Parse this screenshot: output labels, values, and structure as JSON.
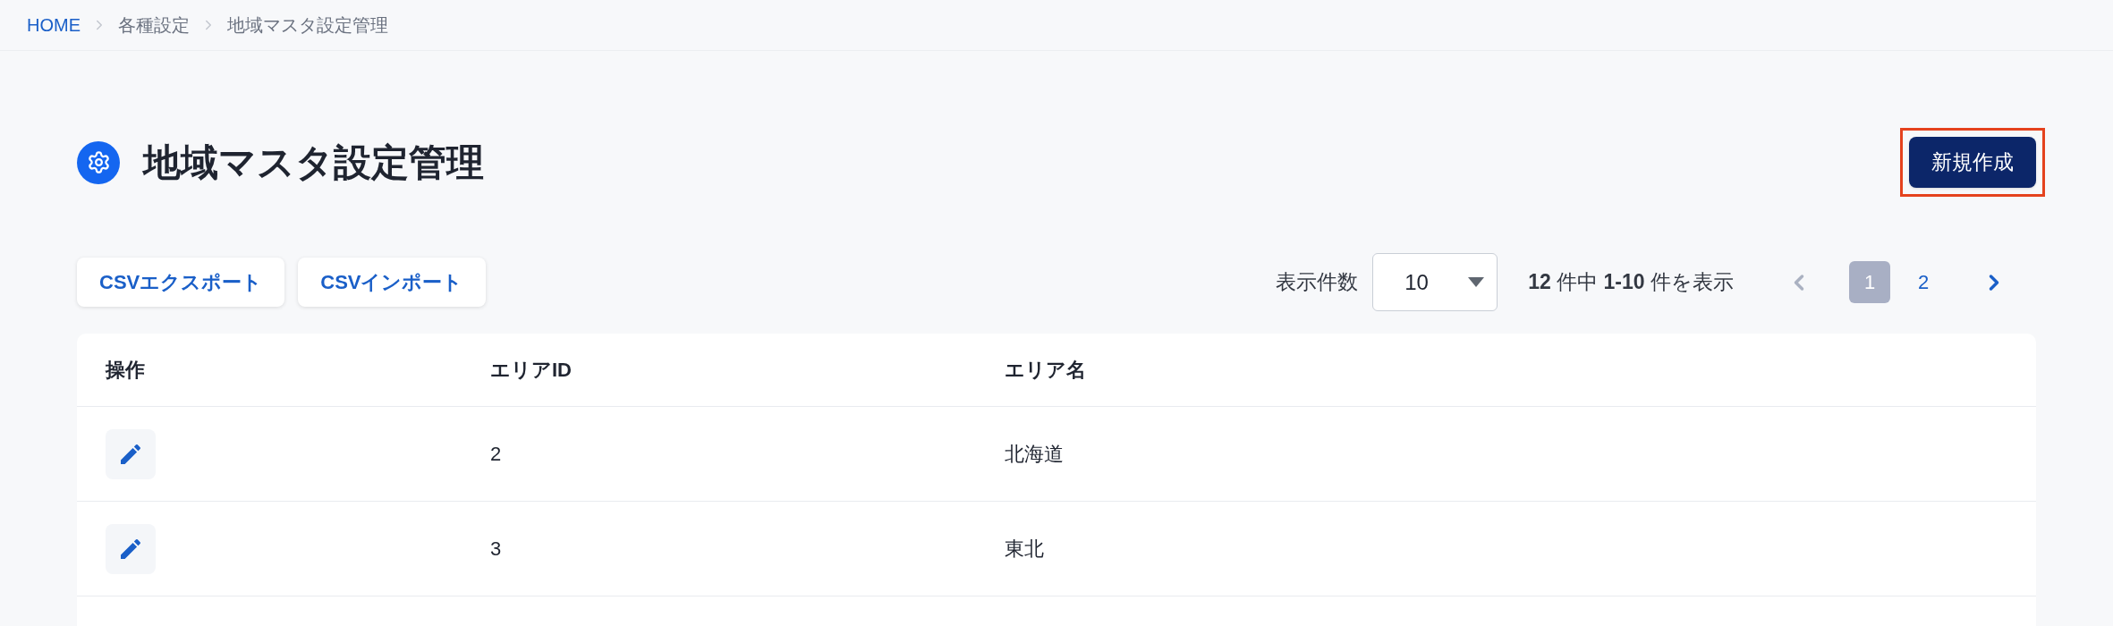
{
  "breadcrumb": [
    {
      "label": "HOME",
      "link": true
    },
    {
      "label": "各種設定",
      "link": false
    },
    {
      "label": "地域マスタ設定管理",
      "link": false
    }
  ],
  "page": {
    "title": "地域マスタ設定管理"
  },
  "new_button": {
    "label": "新規作成",
    "highlighted": true
  },
  "toolbar": {
    "buttons": [
      "CSVエクスポート",
      "CSVインポート"
    ]
  },
  "page_size": {
    "label": "表示件数",
    "value": "10"
  },
  "summary": "**12** 件中 **1-10** 件を表示",
  "pagination": {
    "prev_disabled": true,
    "pages": [
      {
        "label": "1",
        "selected": true
      },
      {
        "label": "2",
        "selected": false
      }
    ],
    "next_disabled": false
  },
  "table": {
    "columns": [
      "操作",
      "エリアID",
      "エリア名"
    ],
    "rows": [
      {
        "area_id": "2",
        "area_name": "北海道"
      },
      {
        "area_id": "3",
        "area_name": "東北"
      }
    ]
  }
}
